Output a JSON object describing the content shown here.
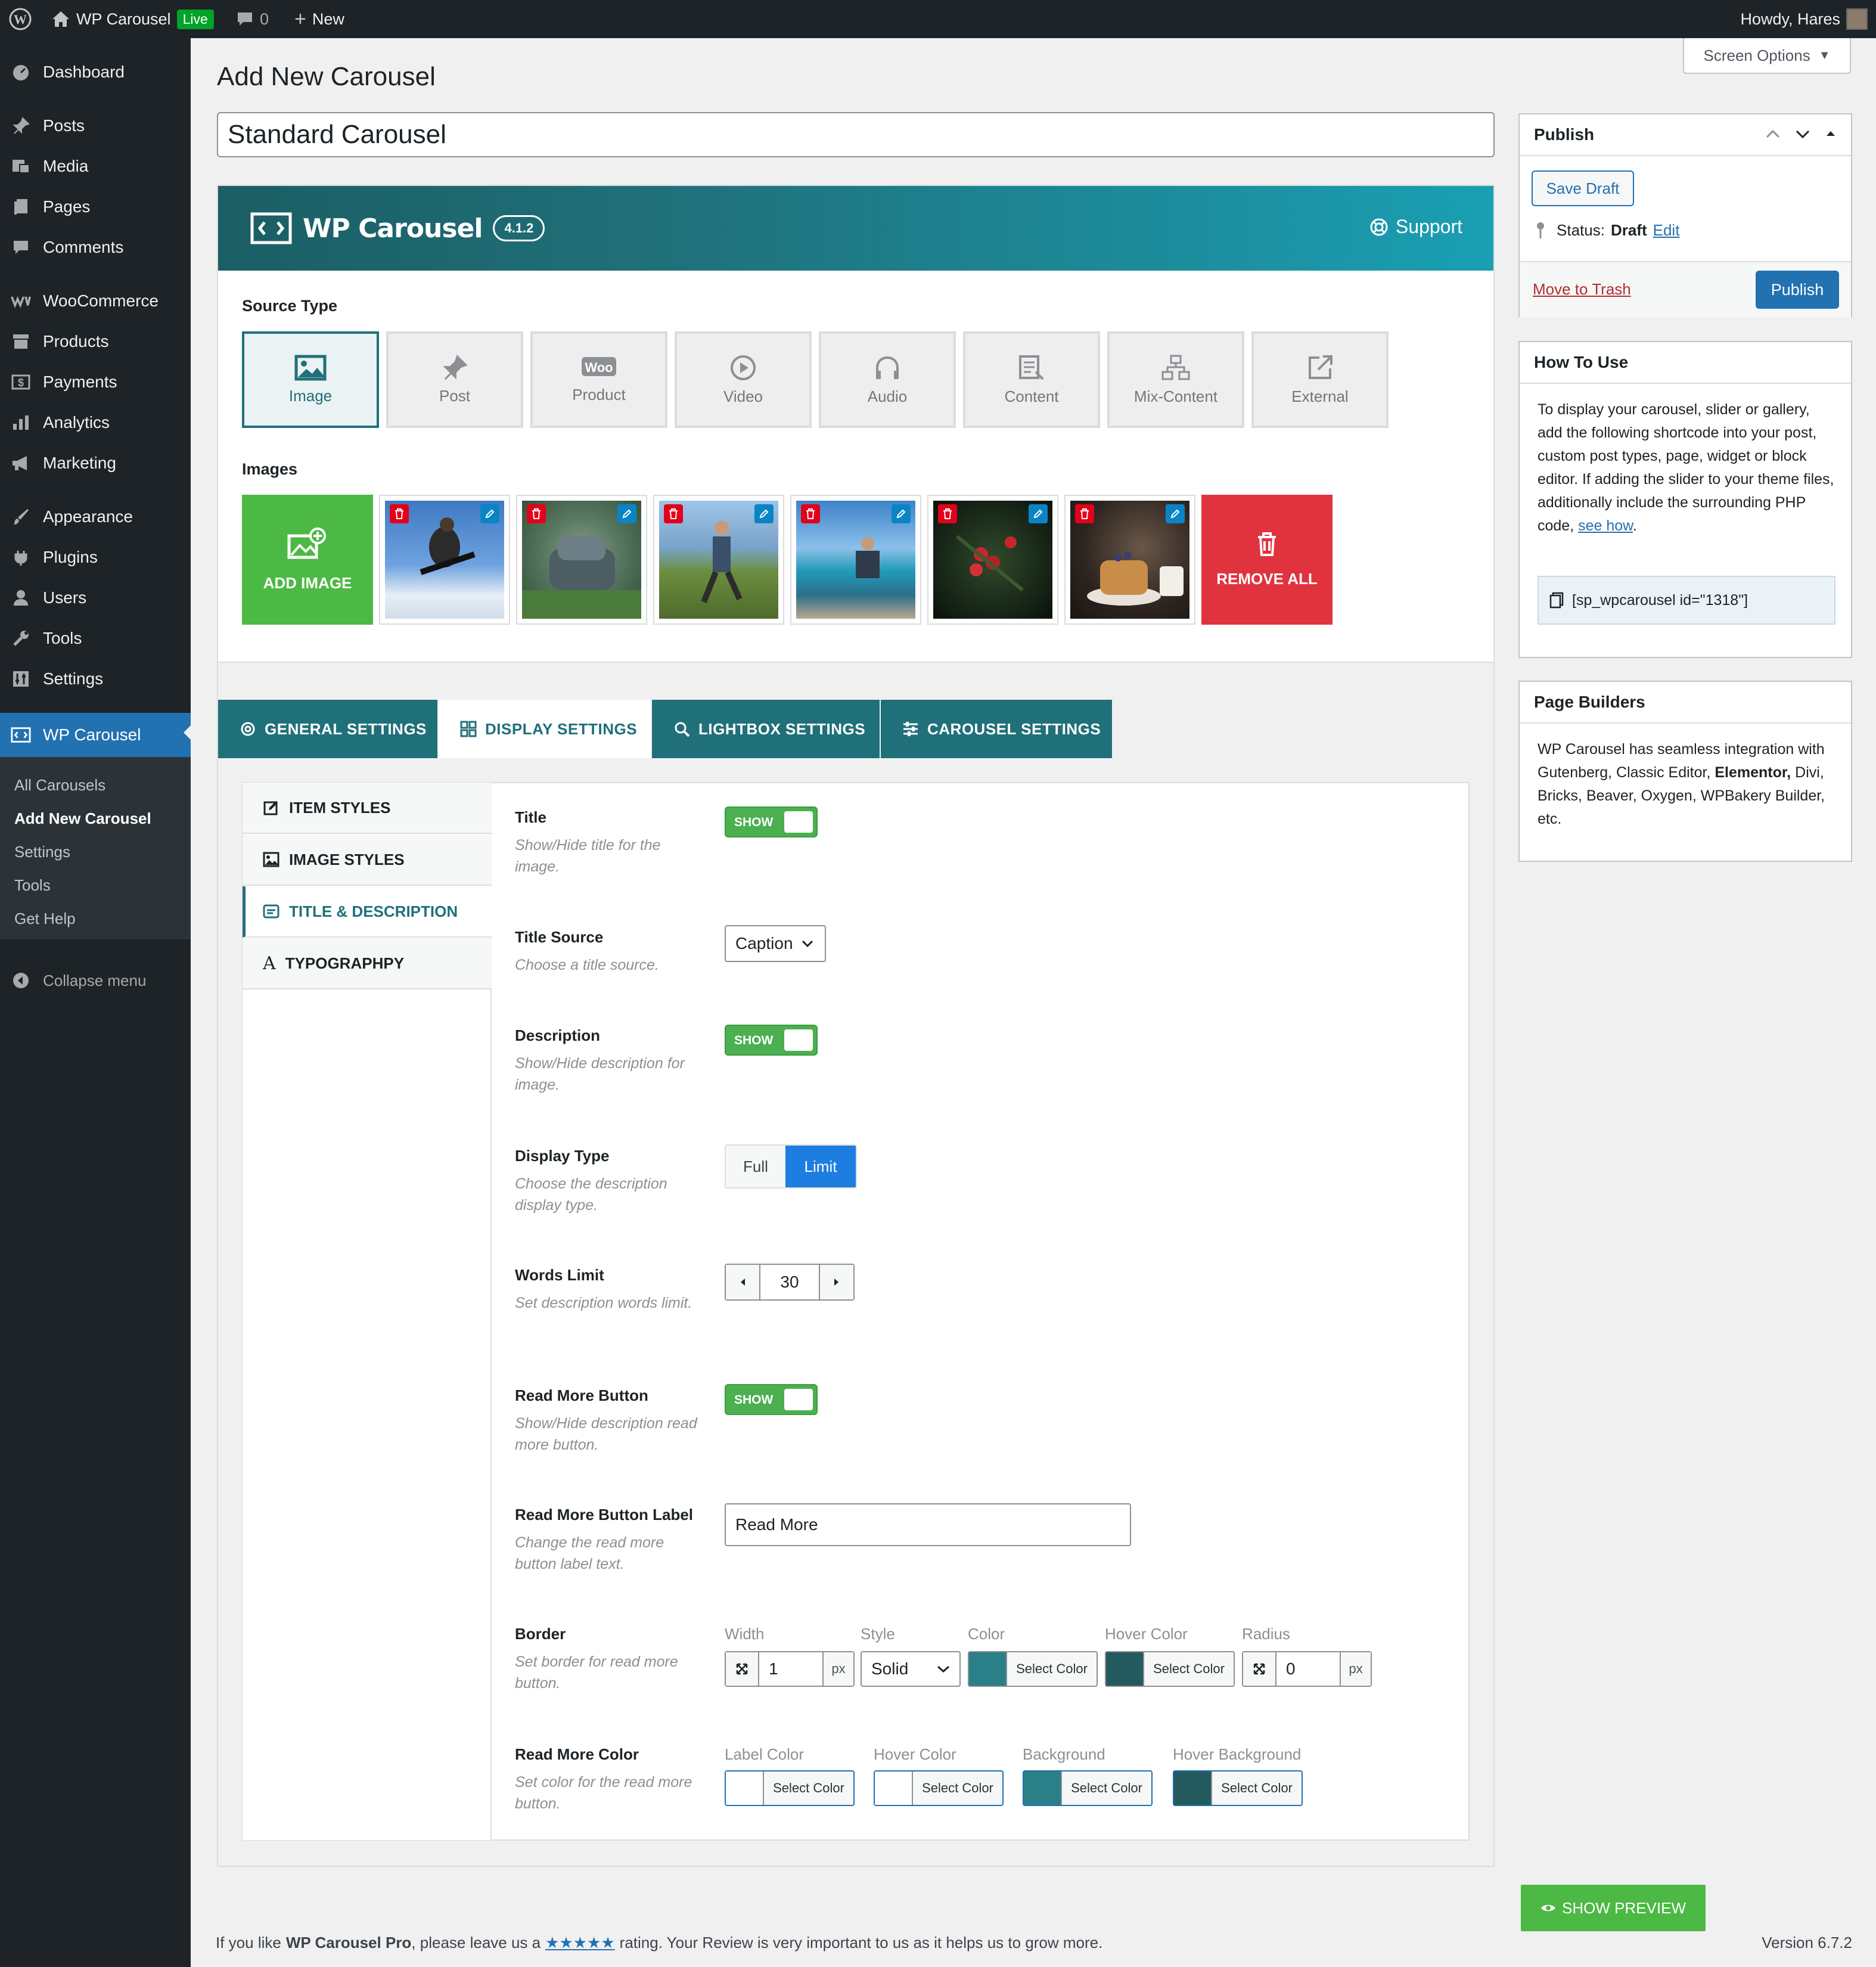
{
  "admin_bar": {
    "site_name": "WP Carousel",
    "live_badge": "Live",
    "comments_count": "0",
    "new_label": "New",
    "howdy": "Howdy, Hares"
  },
  "sidebar": {
    "items": [
      {
        "label": "Dashboard",
        "icon": "dashboard-icon"
      },
      {
        "label": "Posts",
        "icon": "pin-icon"
      },
      {
        "label": "Media",
        "icon": "media-icon"
      },
      {
        "label": "Pages",
        "icon": "page-icon"
      },
      {
        "label": "Comments",
        "icon": "comment-icon"
      },
      {
        "label": "WooCommerce",
        "icon": "woo-icon"
      },
      {
        "label": "Products",
        "icon": "archive-icon"
      },
      {
        "label": "Payments",
        "icon": "dollar-icon"
      },
      {
        "label": "Analytics",
        "icon": "chart-icon"
      },
      {
        "label": "Marketing",
        "icon": "megaphone-icon"
      },
      {
        "label": "Appearance",
        "icon": "brush-icon"
      },
      {
        "label": "Plugins",
        "icon": "plug-icon"
      },
      {
        "label": "Users",
        "icon": "user-icon"
      },
      {
        "label": "Tools",
        "icon": "wrench-icon"
      },
      {
        "label": "Settings",
        "icon": "settings-icon"
      },
      {
        "label": "WP Carousel",
        "icon": "carousel-icon"
      }
    ],
    "submenu": [
      "All Carousels",
      "Add New Carousel",
      "Settings",
      "Tools",
      "Get Help"
    ],
    "collapse": "Collapse menu"
  },
  "screen_options": "Screen Options",
  "page_title": "Add New Carousel",
  "post_title_value": "Standard Carousel",
  "banner": {
    "brand": "WP Carousel",
    "version": "4.1.2",
    "support": "Support"
  },
  "source_type": {
    "label": "Source Type",
    "options": [
      "Image",
      "Post",
      "Product",
      "Video",
      "Audio",
      "Content",
      "Mix-Content",
      "External"
    ],
    "selected": "Image"
  },
  "images": {
    "label": "Images",
    "add": "ADD IMAGE",
    "remove_all": "REMOVE ALL",
    "count": 6
  },
  "tabs": [
    "GENERAL SETTINGS",
    "DISPLAY SETTINGS",
    "LIGHTBOX SETTINGS",
    "CAROUSEL SETTINGS"
  ],
  "subtabs": [
    "ITEM STYLES",
    "IMAGE STYLES",
    "TITLE & DESCRIPTION",
    "TYPOGRAPHPY"
  ],
  "fields": {
    "title": {
      "label": "Title",
      "desc": "Show/Hide title for the image.",
      "toggle": "SHOW"
    },
    "title_source": {
      "label": "Title Source",
      "desc": "Choose a title source.",
      "value": "Caption"
    },
    "description": {
      "label": "Description",
      "desc": "Show/Hide description for image.",
      "toggle": "SHOW"
    },
    "display_type": {
      "label": "Display Type",
      "desc": "Choose the description display type.",
      "options": [
        "Full",
        "Limit"
      ],
      "selected": "Limit"
    },
    "words_limit": {
      "label": "Words Limit",
      "desc": "Set description words limit.",
      "value": "30"
    },
    "read_more_button": {
      "label": "Read More Button",
      "desc": "Show/Hide description read more button.",
      "toggle": "SHOW"
    },
    "read_more_label": {
      "label": "Read More Button Label",
      "desc": "Change the read more button label text.",
      "value": "Read More"
    },
    "border": {
      "label": "Border",
      "desc": "Set border for read more button.",
      "width_label": "Width",
      "width": "1",
      "unit": "px",
      "style_label": "Style",
      "style": "Solid",
      "color_label": "Color",
      "hover_color_label": "Hover Color",
      "radius_label": "Radius",
      "radius": "0",
      "select_color": "Select Color"
    },
    "read_more_color": {
      "label": "Read More Color",
      "desc": "Set color for the read more button.",
      "label_color": "Label Color",
      "hover_color": "Hover Color",
      "background": "Background",
      "hover_background": "Hover Background",
      "select_color": "Select Color"
    }
  },
  "colors": {
    "teal": "#20707a",
    "teal_dark": "#1b5e64",
    "swatch_teal": "#2b7f88",
    "swatch_dark": "#225a5e",
    "green": "#4caf50",
    "red": "#e0333e",
    "blue": "#2271b1"
  },
  "publish": {
    "title": "Publish",
    "save_draft": "Save Draft",
    "status_label": "Status:",
    "status_value": "Draft",
    "edit": "Edit",
    "trash": "Move to Trash",
    "publish": "Publish"
  },
  "how_to_use": {
    "title": "How To Use",
    "text": "To display your carousel, slider or gallery, add the following shortcode into your post, custom post types, page, widget or block editor. If adding the slider to your theme files, additionally include the surrounding PHP code,",
    "link": "see how",
    "shortcode": "[sp_wpcarousel id=\"1318\"]"
  },
  "page_builders": {
    "title": "Page Builders",
    "text_before": "WP Carousel has seamless integration with Gutenberg, Classic Editor,",
    "bold": "Elementor,",
    "text_after": "Divi, Bricks, Beaver, Oxygen, WPBakery Builder, etc."
  },
  "show_preview": "SHOW PREVIEW",
  "footer": {
    "text1": "If you like",
    "brand": "WP Carousel Pro",
    "text2": ", please leave us a",
    "stars": "★★★★★",
    "text3": "rating. Your Review is very important to us as it helps us to grow more.",
    "version": "Version 6.7.2"
  }
}
